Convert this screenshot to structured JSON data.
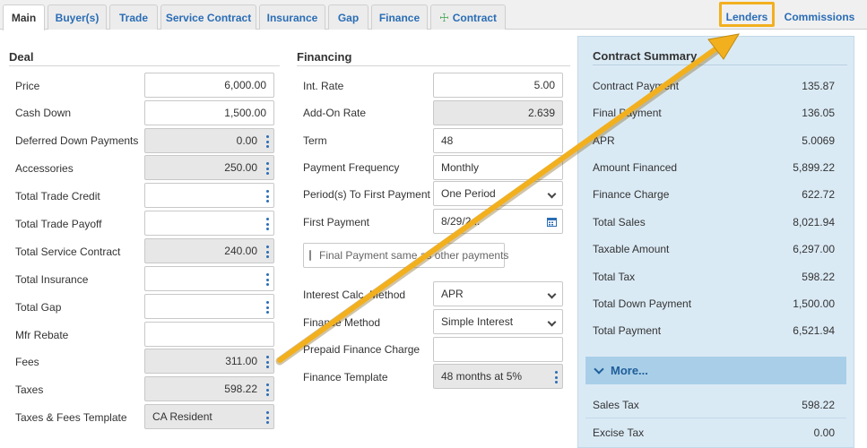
{
  "tabs": [
    {
      "label": "Main"
    },
    {
      "label": "Buyer(s)"
    },
    {
      "label": "Trade"
    },
    {
      "label": "Service Contract"
    },
    {
      "label": "Insurance"
    },
    {
      "label": "Gap"
    },
    {
      "label": "Finance"
    },
    {
      "label": "Contract"
    },
    {
      "label": "Lenders"
    },
    {
      "label": "Commissions"
    }
  ],
  "deal": {
    "title": "Deal",
    "rows": [
      {
        "label": "Price",
        "value": "6,000.00"
      },
      {
        "label": "Cash Down",
        "value": "1,500.00"
      },
      {
        "label": "Deferred Down Payments",
        "value": "0.00"
      },
      {
        "label": "Accessories",
        "value": "250.00"
      },
      {
        "label": "Total Trade Credit",
        "value": ""
      },
      {
        "label": "Total Trade Payoff",
        "value": ""
      },
      {
        "label": "Total Service Contract",
        "value": "240.00"
      },
      {
        "label": "Total Insurance",
        "value": ""
      },
      {
        "label": "Total Gap",
        "value": ""
      },
      {
        "label": "Mfr Rebate",
        "value": ""
      },
      {
        "label": "Fees",
        "value": "311.00"
      },
      {
        "label": "Taxes",
        "value": "598.22"
      },
      {
        "label": "Taxes & Fees Template",
        "value": "CA Resident"
      }
    ]
  },
  "financing": {
    "title": "Financing",
    "int_rate": {
      "label": "Int. Rate",
      "value": "5.00"
    },
    "add_on_rate": {
      "label": "Add-On Rate",
      "value": "2.639"
    },
    "term": {
      "label": "Term",
      "value": "48"
    },
    "payment_frequency": {
      "label": "Payment Frequency",
      "value": "Monthly"
    },
    "periods_to_first": {
      "label": "Period(s) To First Payment",
      "value": "One Period"
    },
    "first_payment": {
      "label": "First Payment",
      "value": "8/29/2..."
    },
    "final_payment_same": {
      "label": "Final Payment same as other payments"
    },
    "interest_calc_method": {
      "label": "Interest Calc. Method",
      "value": "APR"
    },
    "finance_method": {
      "label": "Finance Method",
      "value": "Simple Interest"
    },
    "prepaid_finance_charge": {
      "label": "Prepaid Finance Charge",
      "value": ""
    },
    "finance_template": {
      "label": "Finance Template",
      "value": "48 months at 5%"
    }
  },
  "summary": {
    "title": "Contract Summary",
    "rows": [
      {
        "label": "Contract Payment",
        "value": "135.87"
      },
      {
        "label": "Final Payment",
        "value": "136.05"
      },
      {
        "label": "APR",
        "value": "5.0069"
      },
      {
        "label": "Amount Financed",
        "value": "5,899.22"
      },
      {
        "label": "Finance Charge",
        "value": "622.72"
      },
      {
        "label": "Total Sales",
        "value": "8,021.94"
      },
      {
        "label": "Taxable Amount",
        "value": "6,297.00"
      },
      {
        "label": "Total Tax",
        "value": "598.22"
      },
      {
        "label": "Total Down Payment",
        "value": "1,500.00"
      },
      {
        "label": "Total Payment",
        "value": "6,521.94"
      }
    ],
    "more_label": "More...",
    "extra_rows": [
      {
        "label": "Sales Tax",
        "value": "598.22"
      },
      {
        "label": "Excise Tax",
        "value": "0.00"
      }
    ]
  },
  "colors": {
    "accent": "#2a6db5",
    "highlight": "#f2b01e",
    "summary_bg": "#daeaf5",
    "more_bar": "#a9cfe8"
  }
}
